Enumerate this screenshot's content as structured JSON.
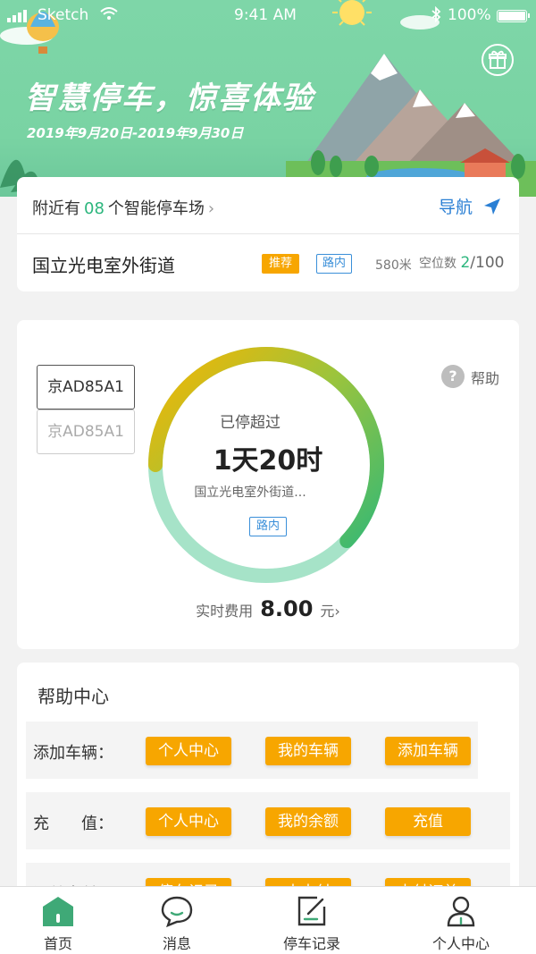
{
  "status_bar": {
    "carrier": "Sketch",
    "time": "9:41 AM",
    "battery": "100%"
  },
  "banner": {
    "title": "智慧停车，惊喜体验",
    "date_range": "2019年9月20日-2019年9月30日"
  },
  "nearby": {
    "prefix": "附近有",
    "count": "08",
    "suffix": "个智能停车场",
    "chevron": "›",
    "nav_label": "导航"
  },
  "recommended_lot": {
    "name": "国立光电室外街道",
    "tag_recommend": "推荐",
    "tag_type": "路内",
    "distance": "580米",
    "spaces_label": "空位数",
    "spaces_available": "2",
    "spaces_total": "/100"
  },
  "parking": {
    "plates": [
      "京AD85A1",
      "京AD85A1"
    ],
    "help_label": "帮助",
    "status_label": "已停超过",
    "duration": "1天20时",
    "location": "国立光电室外街道...",
    "tag_type": "路内",
    "progress": 0.62,
    "fee_label": "实时费用",
    "fee_amount": "8.00",
    "fee_unit": "元",
    "fee_chevron": "›"
  },
  "help_center": {
    "title": "帮助中心",
    "rows": [
      {
        "label": "添加车辆：",
        "buttons": [
          "个人中心",
          "我的车辆",
          "添加车辆"
        ]
      },
      {
        "label": "充　　值：",
        "buttons": [
          "个人中心",
          "我的余额",
          "充值"
        ]
      },
      {
        "label": "订单支付：",
        "buttons": [
          "停车记录",
          "去支付",
          "支付订单"
        ]
      }
    ]
  },
  "tabbar": {
    "items": [
      "首页",
      "消息",
      "停车记录",
      "个人中心"
    ]
  },
  "colors": {
    "accent_green": "#2cb67d",
    "orange": "#f7a600",
    "blue": "#2a7fd4"
  }
}
